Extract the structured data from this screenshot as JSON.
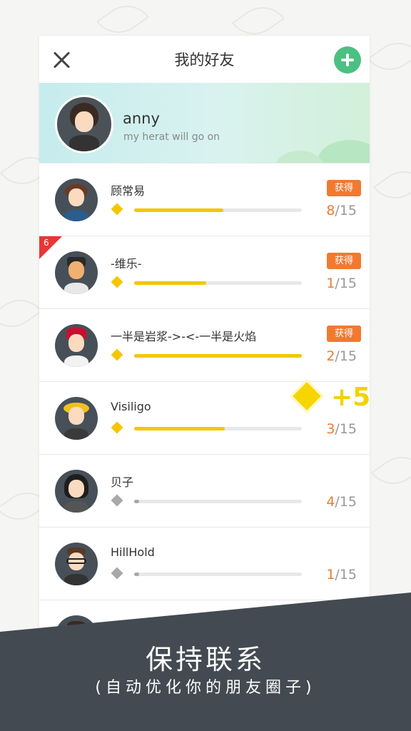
{
  "header": {
    "title": "我的好友"
  },
  "profile": {
    "name": "anny",
    "tagline": "my herat will go on"
  },
  "friends": [
    {
      "name": "顾常易",
      "badge": "获得",
      "count": "8",
      "total": "/15",
      "progress": 0.53,
      "active": true
    },
    {
      "name": "-维乐-",
      "badge": "获得",
      "count": "1",
      "total": "/15",
      "progress": 0.43,
      "active": true,
      "corner": "6"
    },
    {
      "name": "一半是岩浆->-<-一半是火焰",
      "badge": "获得",
      "count": "2",
      "total": "/15",
      "progress": 1.0,
      "active": true
    },
    {
      "name": "Visiligo",
      "count": "3",
      "total": "/15",
      "progress": 0.54,
      "active": true
    },
    {
      "name": "贝子",
      "count": "4",
      "total": "/15",
      "progress": 0.03,
      "active": false
    },
    {
      "name": "HillHold",
      "count": "1",
      "total": "/15",
      "progress": 0.03,
      "active": false
    }
  ],
  "reward": {
    "text": "+5"
  },
  "banner": {
    "title": "保持联系",
    "subtitle": "(自动优化你的朋友圈子)"
  },
  "icons": {
    "close": "close-icon",
    "add": "add-icon",
    "points": "diamond-icon"
  },
  "colors": {
    "accent": "#4cc081",
    "badge": "#f17a30",
    "progress": "#f5c600",
    "banner": "#434a52"
  }
}
